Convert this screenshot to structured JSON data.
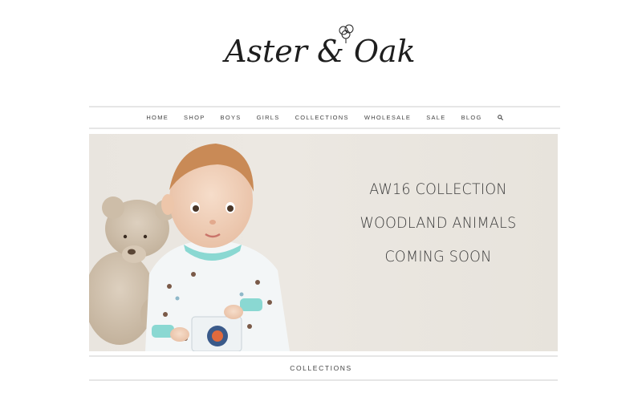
{
  "brand": {
    "logo_text": "Aster & Oak",
    "logo_icon": "cotton-flower-icon"
  },
  "nav": {
    "items": [
      {
        "label": "HOME"
      },
      {
        "label": "SHOP"
      },
      {
        "label": "BOYS"
      },
      {
        "label": "GIRLS"
      },
      {
        "label": "COLLECTIONS"
      },
      {
        "label": "WHOLESALE"
      },
      {
        "label": "SALE"
      },
      {
        "label": "BLOG"
      }
    ],
    "search_icon": "search-icon"
  },
  "hero": {
    "lines": [
      "AW16 COLLECTION",
      "WOODLAND ANIMALS",
      "COMING SOON"
    ]
  },
  "footer": {
    "section_label": "COLLECTIONS"
  },
  "colors": {
    "text": "#3a3a3a",
    "rule": "#e6e6e6",
    "hero_bg": "#e9e5df",
    "accent_cuff": "#7fd6d0"
  }
}
